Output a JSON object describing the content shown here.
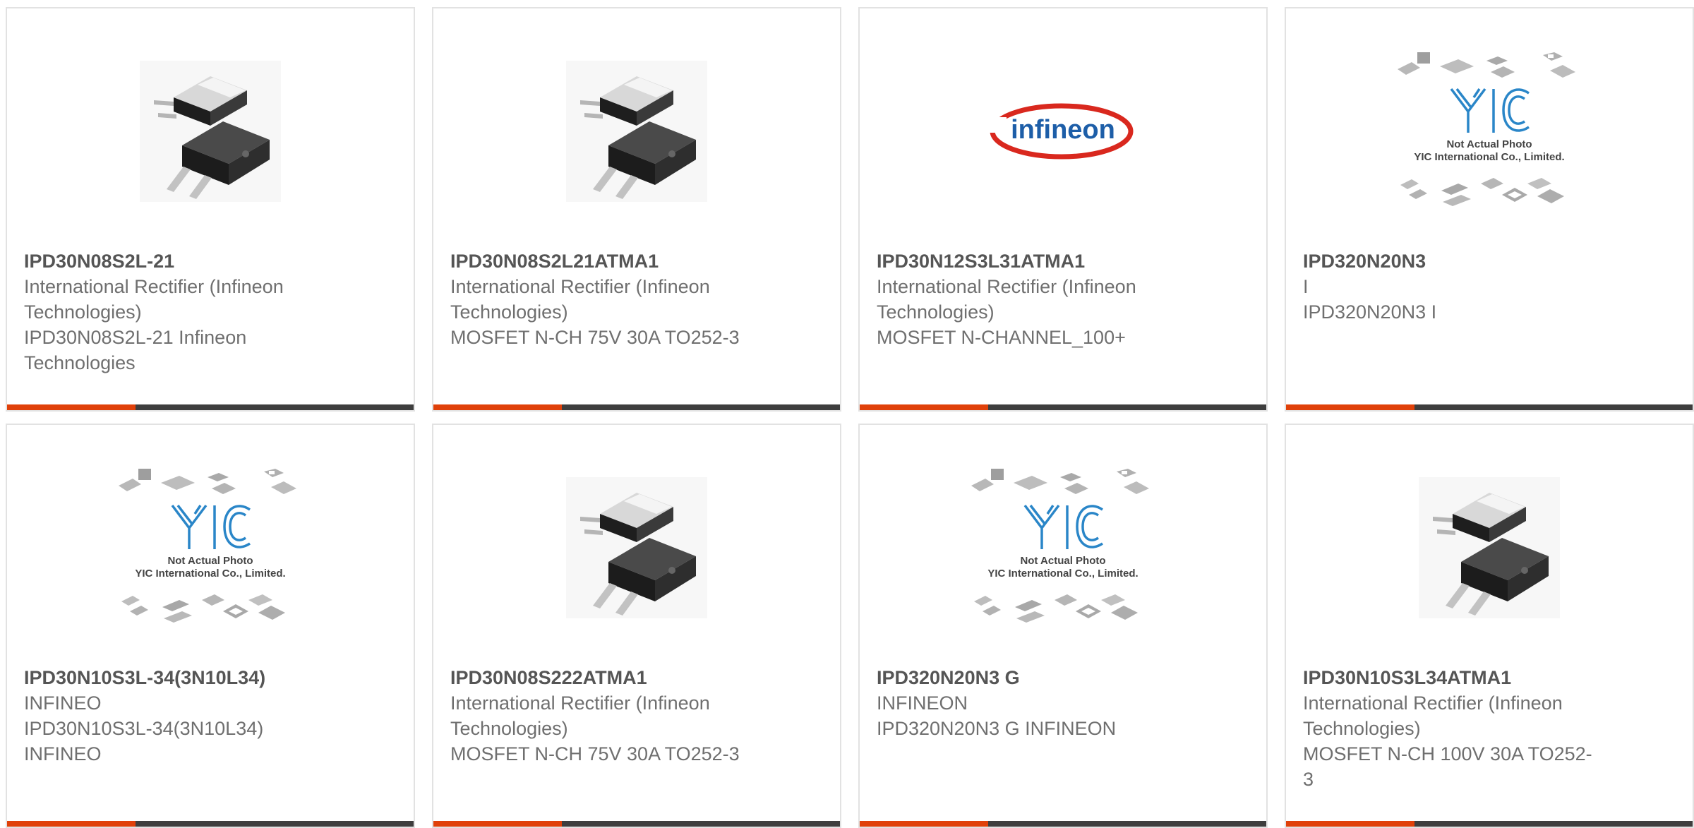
{
  "products": [
    {
      "part_number": "IPD30N08S2L-21",
      "manufacturer": "International Rectifier (Infineon Technologies)",
      "description": "IPD30N08S2L-21 Infineon Technologies",
      "image": "dpak-package-photo"
    },
    {
      "part_number": "IPD30N08S2L21ATMA1",
      "manufacturer": "International Rectifier (Infineon Technologies)",
      "description": "MOSFET N-CH 75V 30A TO252-3",
      "image": "dpak-package-photo"
    },
    {
      "part_number": "IPD30N12S3L31ATMA1",
      "manufacturer": "International Rectifier (Infineon Technologies)",
      "description": "MOSFET N-CHANNEL_100+",
      "image": "infineon-logo",
      "logo_text": "infineon"
    },
    {
      "part_number": "IPD320N20N3",
      "manufacturer": "I",
      "description": "IPD320N20N3 I",
      "image": "yic-placeholder",
      "placeholder_line1": "Not Actual Photo",
      "placeholder_line2": "YIC International Co., Limited."
    },
    {
      "part_number": "IPD30N10S3L-34(3N10L34)",
      "manufacturer": "INFINEO",
      "description": "IPD30N10S3L-34(3N10L34) INFINEO",
      "image": "yic-placeholder",
      "placeholder_line1": "Not Actual Photo",
      "placeholder_line2": "YIC International Co., Limited."
    },
    {
      "part_number": "IPD30N08S222ATMA1",
      "manufacturer": "International Rectifier (Infineon Technologies)",
      "description": "MOSFET N-CH 75V 30A TO252-3",
      "image": "dpak-package-photo"
    },
    {
      "part_number": "IPD320N20N3 G",
      "manufacturer": "INFINEON",
      "description": "IPD320N20N3 G INFINEON",
      "image": "yic-placeholder",
      "placeholder_line1": "Not Actual Photo",
      "placeholder_line2": "YIC International Co., Limited."
    },
    {
      "part_number": "IPD30N10S3L34ATMA1",
      "manufacturer": "International Rectifier (Infineon Technologies)",
      "description": "MOSFET N-CH 100V 30A TO252-3",
      "image": "dpak-package-photo"
    }
  ],
  "colors": {
    "accent": "#e0410a",
    "bar": "#3e3e3e",
    "infineon_red": "#d9281e",
    "infineon_blue": "#1d5ea8",
    "yic_blue": "#2a86c8"
  }
}
